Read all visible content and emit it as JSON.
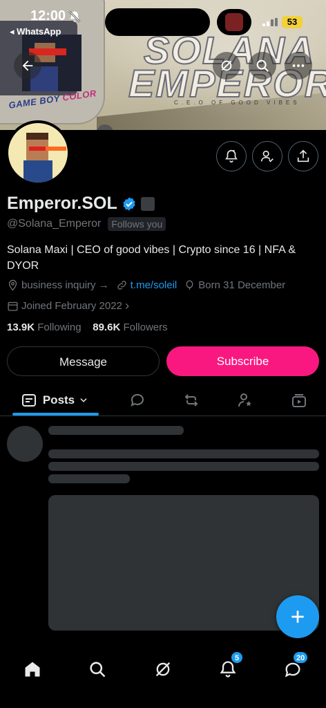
{
  "status_bar": {
    "time": "12:00",
    "back_app": "◂ WhatsApp",
    "battery": "53"
  },
  "banner": {
    "title_line1": "SOLANA",
    "title_line2": "EMPEROR",
    "subtitle": "C.E.O OF GOOD VIBES",
    "gameboy_logo": "GAME BOY",
    "gameboy_logo_color": "COLOR"
  },
  "profile": {
    "name": "Emperor.SOL",
    "handle": "@Solana_Emperor",
    "follows_you": "Follows you",
    "bio": "Solana Maxi | CEO of good vibes | Crypto since 16 | NFA & DYOR",
    "category": "business inquiry",
    "category_arrow": "→",
    "link": "t.me/soleil",
    "born": "Born 31 December",
    "joined": "Joined February 2022",
    "joined_chevron": "›",
    "following_count": "13.9K",
    "following_label": "Following",
    "followers_count": "89.6K",
    "followers_label": "Followers"
  },
  "actions": {
    "message": "Message",
    "subscribe": "Subscribe"
  },
  "tabs": {
    "posts": "Posts"
  },
  "bottom_nav": {
    "notifications_badge": "5",
    "messages_badge": "20"
  },
  "colors": {
    "accent": "#1d9bf0",
    "subscribe": "#f91880",
    "background": "#000000",
    "secondary_text": "#71767b"
  },
  "icons": [
    "back-arrow-icon",
    "grok-icon",
    "search-icon",
    "more-icon",
    "notification-bell-icon",
    "follow-check-icon",
    "share-icon",
    "verified-icon",
    "location-icon",
    "link-icon",
    "birthday-icon",
    "calendar-icon",
    "chevron-down-icon",
    "replies-icon",
    "reposts-icon",
    "highlights-icon",
    "media-icon",
    "plus-icon",
    "home-icon",
    "grok-nav-icon",
    "bell-icon",
    "messages-icon"
  ]
}
